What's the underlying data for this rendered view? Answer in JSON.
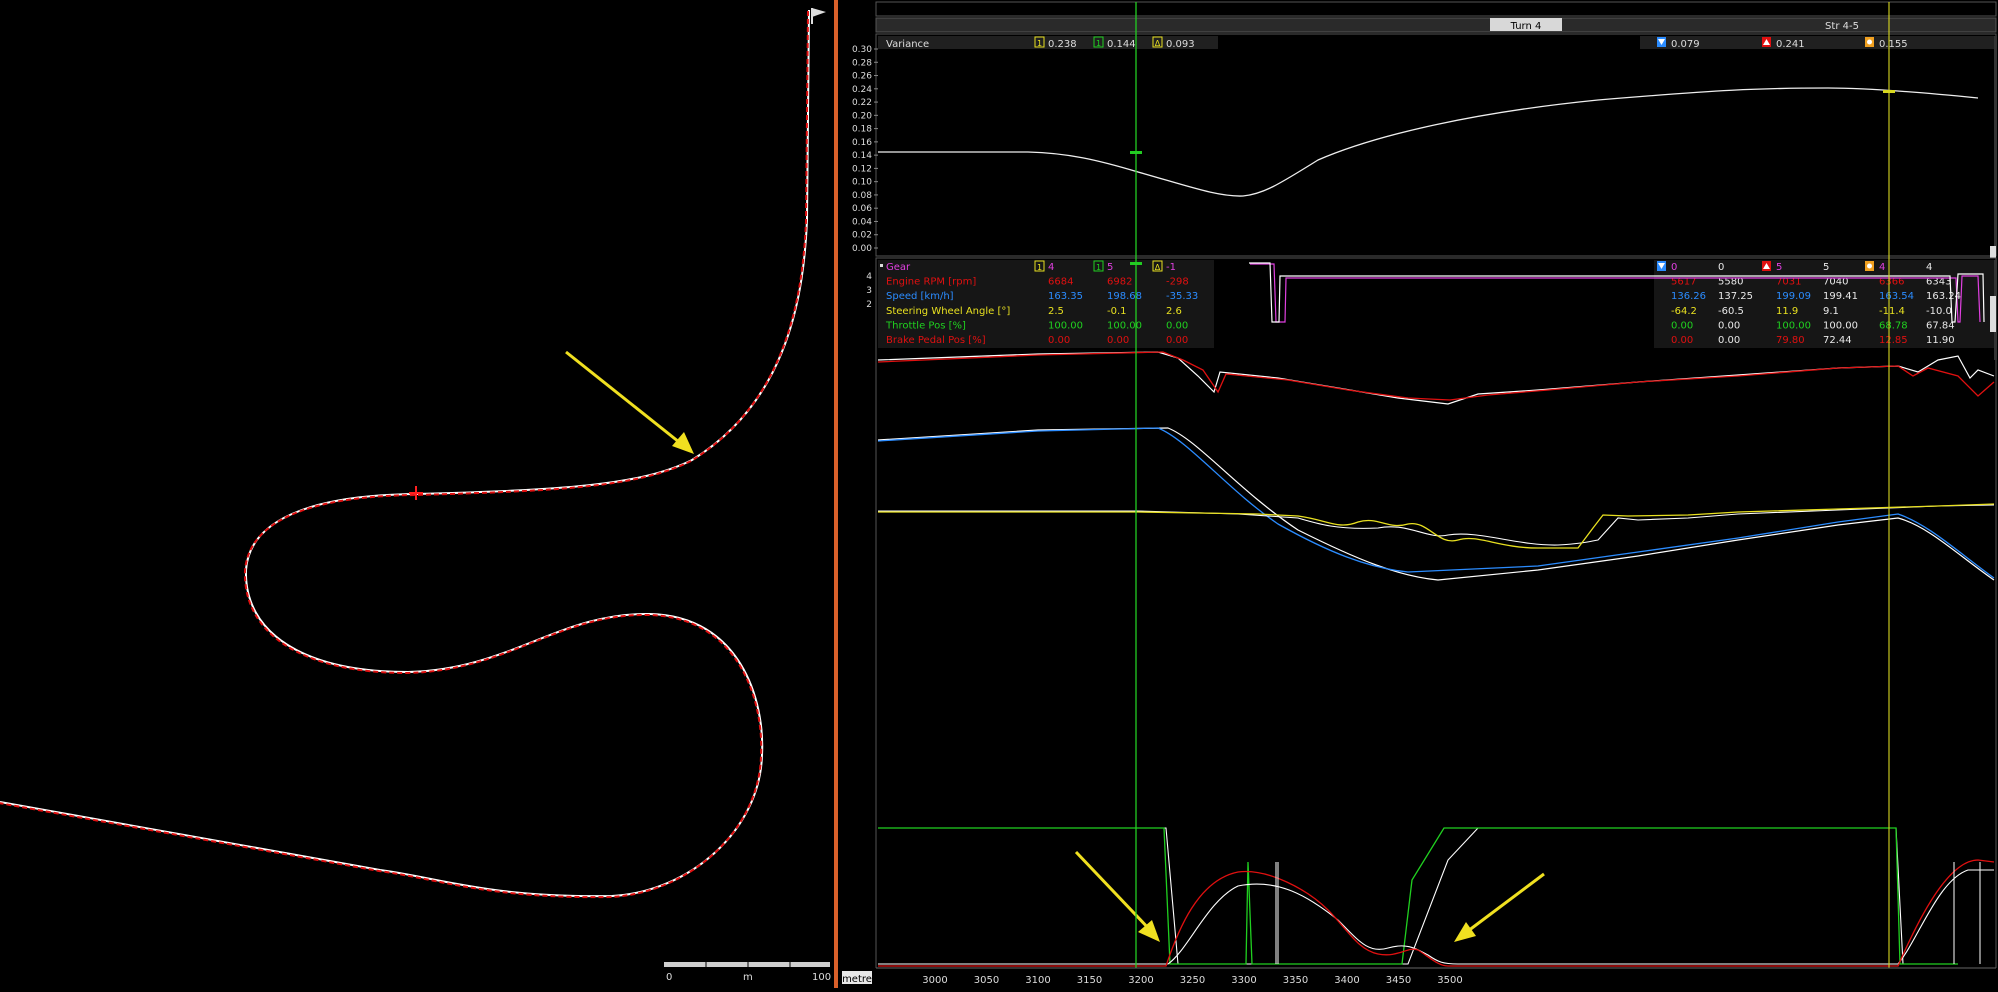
{
  "track_map": {
    "scale_bar": {
      "min_label": "0",
      "unit_label": "m",
      "max_label": "100"
    }
  },
  "section_bar": {
    "active_section": "Turn 4",
    "next_section": "Str 4-5"
  },
  "variance_panel": {
    "title": "Variance",
    "cursor1_badge": "1",
    "cursor1_value": "0.238",
    "cursor2_badge": "1",
    "cursor2_value": "0.144",
    "delta_badge": "Δ",
    "delta_value": "0.093",
    "min_value": "0.079",
    "max_value": "0.241",
    "avg_value": "0.155",
    "y_ticks": [
      "0.00",
      "0.02",
      "0.04",
      "0.06",
      "0.08",
      "0.10",
      "0.12",
      "0.14",
      "0.16",
      "0.18",
      "0.20",
      "0.22",
      "0.24",
      "0.26",
      "0.28",
      "0.30"
    ]
  },
  "channels_panel": {
    "header_badges": {
      "c1": "1",
      "c2": "1",
      "delta": "Δ"
    },
    "gear_y_ticks": [
      "2",
      "3",
      "4"
    ],
    "channels": [
      {
        "name": "Gear",
        "c1": "4",
        "c2": "5",
        "delta": "-1",
        "min_a": "0",
        "min_b": "0",
        "max_a": "5",
        "max_b": "5",
        "avg_a": "4",
        "avg_b": "4",
        "color": "#e040e0"
      },
      {
        "name": "Engine RPM [rpm]",
        "c1": "6684",
        "c2": "6982",
        "delta": "-298",
        "min_a": "5617",
        "min_b": "5580",
        "max_a": "7031",
        "max_b": "7040",
        "avg_a": "6366",
        "avg_b": "6343",
        "color": "#e01010"
      },
      {
        "name": "Speed [km/h]",
        "c1": "163.35",
        "c2": "198.68",
        "delta": "-35.33",
        "min_a": "136.26",
        "min_b": "137.25",
        "max_a": "199.09",
        "max_b": "199.41",
        "avg_a": "163.54",
        "avg_b": "163.24",
        "color": "#2b8cff"
      },
      {
        "name": "Steering Wheel Angle [°]",
        "c1": "2.5",
        "c2": "-0.1",
        "delta": "2.6",
        "min_a": "-64.2",
        "min_b": "-60.5",
        "max_a": "11.9",
        "max_b": "9.1",
        "avg_a": "-11.4",
        "avg_b": "-10.0",
        "color": "#e8e020"
      },
      {
        "name": "Throttle Pos [%]",
        "c1": "100.00",
        "c2": "100.00",
        "delta": "0.00",
        "min_a": "0.00",
        "min_b": "0.00",
        "max_a": "100.00",
        "max_b": "100.00",
        "avg_a": "68.78",
        "avg_b": "67.84",
        "color": "#20d020"
      },
      {
        "name": "Brake Pedal Pos [%]",
        "c1": "0.00",
        "c2": "0.00",
        "delta": "0.00",
        "min_a": "0.00",
        "min_b": "0.00",
        "max_a": "79.80",
        "max_b": "72.44",
        "avg_a": "12.85",
        "avg_b": "11.90",
        "color": "#e01010"
      }
    ]
  },
  "x_axis": {
    "unit_label": "metre",
    "ticks": [
      "3000",
      "3050",
      "3100",
      "3150",
      "3200",
      "3250",
      "3300",
      "3350",
      "3400",
      "3450",
      "3500"
    ]
  },
  "colors": {
    "reference_trace": "#ffffff",
    "rpm": "#e01010",
    "speed": "#2b8cff",
    "steering": "#e8e020",
    "throttle": "#20d020",
    "brake": "#e01010",
    "cursor_main": "#22cc22",
    "cursor_second": "#d8d820",
    "annotation_arrow": "#f0e020",
    "splitter": "#d9602a"
  }
}
